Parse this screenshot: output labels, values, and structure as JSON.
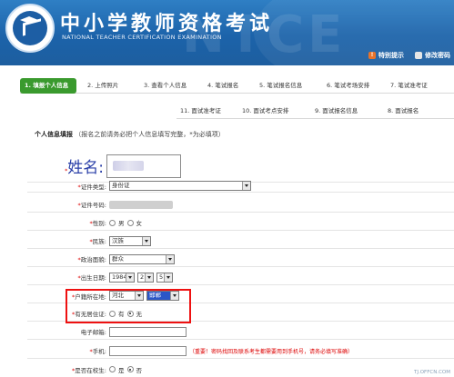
{
  "header": {
    "watermark": "NTCE",
    "title_cn": "中小学教师资格考试",
    "title_en": "NATIONAL TEACHER CERTIFICATION EXAMINATION",
    "link_help": "特别提示",
    "link_password": "修改密码"
  },
  "steps_row1": [
    "1. 填报个人信息",
    "2. 上传照片",
    "3. 查看个人信息",
    "4. 笔试报名",
    "5. 笔试报名信息",
    "6. 笔试考场安排",
    "7. 笔试准考证"
  ],
  "steps_row2": [
    "11. 面试准考证",
    "10. 面试考点安排",
    "9. 面试报名信息",
    "8. 面试报名"
  ],
  "section": {
    "title": "个人信息填报",
    "hint": "（报名之前请务必把个人信息填写完整，",
    "hint_req": "*",
    "hint_end": "为必填项）"
  },
  "form": {
    "name_label": "姓名:",
    "id_type_label": "证件类型:",
    "id_type_value": "身份证",
    "id_no_label": "证件号码:",
    "gender_label": "性别:",
    "gender_male": "男",
    "gender_female": "女",
    "ethnic_label": "民族:",
    "ethnic_value": "汉族",
    "political_label": "政治面貌:",
    "political_value": "群众",
    "birth_label": "出生日期:",
    "birth_year": "1984",
    "birth_month": "2",
    "birth_day": "5",
    "hukou_label": "户籍所在地:",
    "hukou_province": "河北",
    "hukou_city": "邯郸",
    "residence_label": "有无居住证:",
    "residence_yes": "有",
    "residence_no": "无",
    "email_label": "电子邮箱:",
    "phone_label": "手机:",
    "phone_note": "（重要！密码找回及联系考生都需要用到手机号，请务必填写准确）",
    "enrolled_label": "是否在校生:",
    "enrolled_yes": "是",
    "enrolled_no": "否"
  },
  "footer_watermark": "TJ.OFFCN.COM",
  "colors": {
    "header": "#1d63aa",
    "active_step": "#3a9a2e",
    "highlight": "#e11111",
    "required": "#dd0000"
  }
}
